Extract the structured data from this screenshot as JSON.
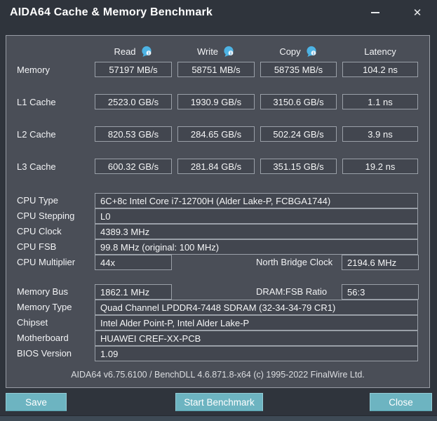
{
  "window": {
    "title": "AIDA64 Cache & Memory Benchmark",
    "close_glyph": "✕"
  },
  "columns": {
    "read": "Read",
    "write": "Write",
    "copy": "Copy",
    "latency": "Latency"
  },
  "benchmark_rows": [
    {
      "label": "Memory",
      "read": "57197 MB/s",
      "write": "58751 MB/s",
      "copy": "58735 MB/s",
      "latency": "104.2 ns"
    },
    {
      "label": "L1 Cache",
      "read": "2523.0 GB/s",
      "write": "1930.9 GB/s",
      "copy": "3150.6 GB/s",
      "latency": "1.1 ns"
    },
    {
      "label": "L2 Cache",
      "read": "820.53 GB/s",
      "write": "284.65 GB/s",
      "copy": "502.24 GB/s",
      "latency": "3.9 ns"
    },
    {
      "label": "L3 Cache",
      "read": "600.32 GB/s",
      "write": "281.84 GB/s",
      "copy": "351.15 GB/s",
      "latency": "19.2 ns"
    }
  ],
  "cpu_info": [
    {
      "label": "CPU Type",
      "value": "6C+8c Intel Core i7-12700H  (Alder Lake-P, FCBGA1744)"
    },
    {
      "label": "CPU Stepping",
      "value": "L0"
    },
    {
      "label": "CPU Clock",
      "value": "4389.3 MHz"
    },
    {
      "label": "CPU FSB",
      "value": "99.8 MHz  (original: 100 MHz)"
    }
  ],
  "cpu_multiplier": {
    "label": "CPU Multiplier",
    "value": "44x",
    "extra_label": "North Bridge Clock",
    "extra_value": "2194.6 MHz"
  },
  "memory_bus": {
    "label": "Memory Bus",
    "value": "1862.1 MHz",
    "extra_label": "DRAM:FSB Ratio",
    "extra_value": "56:3"
  },
  "system_info": [
    {
      "label": "Memory Type",
      "value": "Quad Channel LPDDR4-7448 SDRAM  (32-34-34-79 CR1)"
    },
    {
      "label": "Chipset",
      "value": "Intel Alder Point-P, Intel Alder Lake-P"
    },
    {
      "label": "Motherboard",
      "value": "HUAWEI CREF-XX-PCB"
    },
    {
      "label": "BIOS Version",
      "value": "1.09"
    }
  ],
  "footer": {
    "version_text": "AIDA64 v6.75.6100 / BenchDLL 4.6.871.8-x64  (c) 1995-2022 FinalWire Ltd."
  },
  "buttons": {
    "save": "Save",
    "start": "Start Benchmark",
    "close": "Close"
  },
  "colors": {
    "accent_teal": "#6db4c1",
    "info_icon_blue": "#4db3e4",
    "panel_bg": "#4a4e57",
    "window_bg": "#2f343c",
    "box_bg": "#42464f",
    "box_border": "#9aa0a8"
  }
}
